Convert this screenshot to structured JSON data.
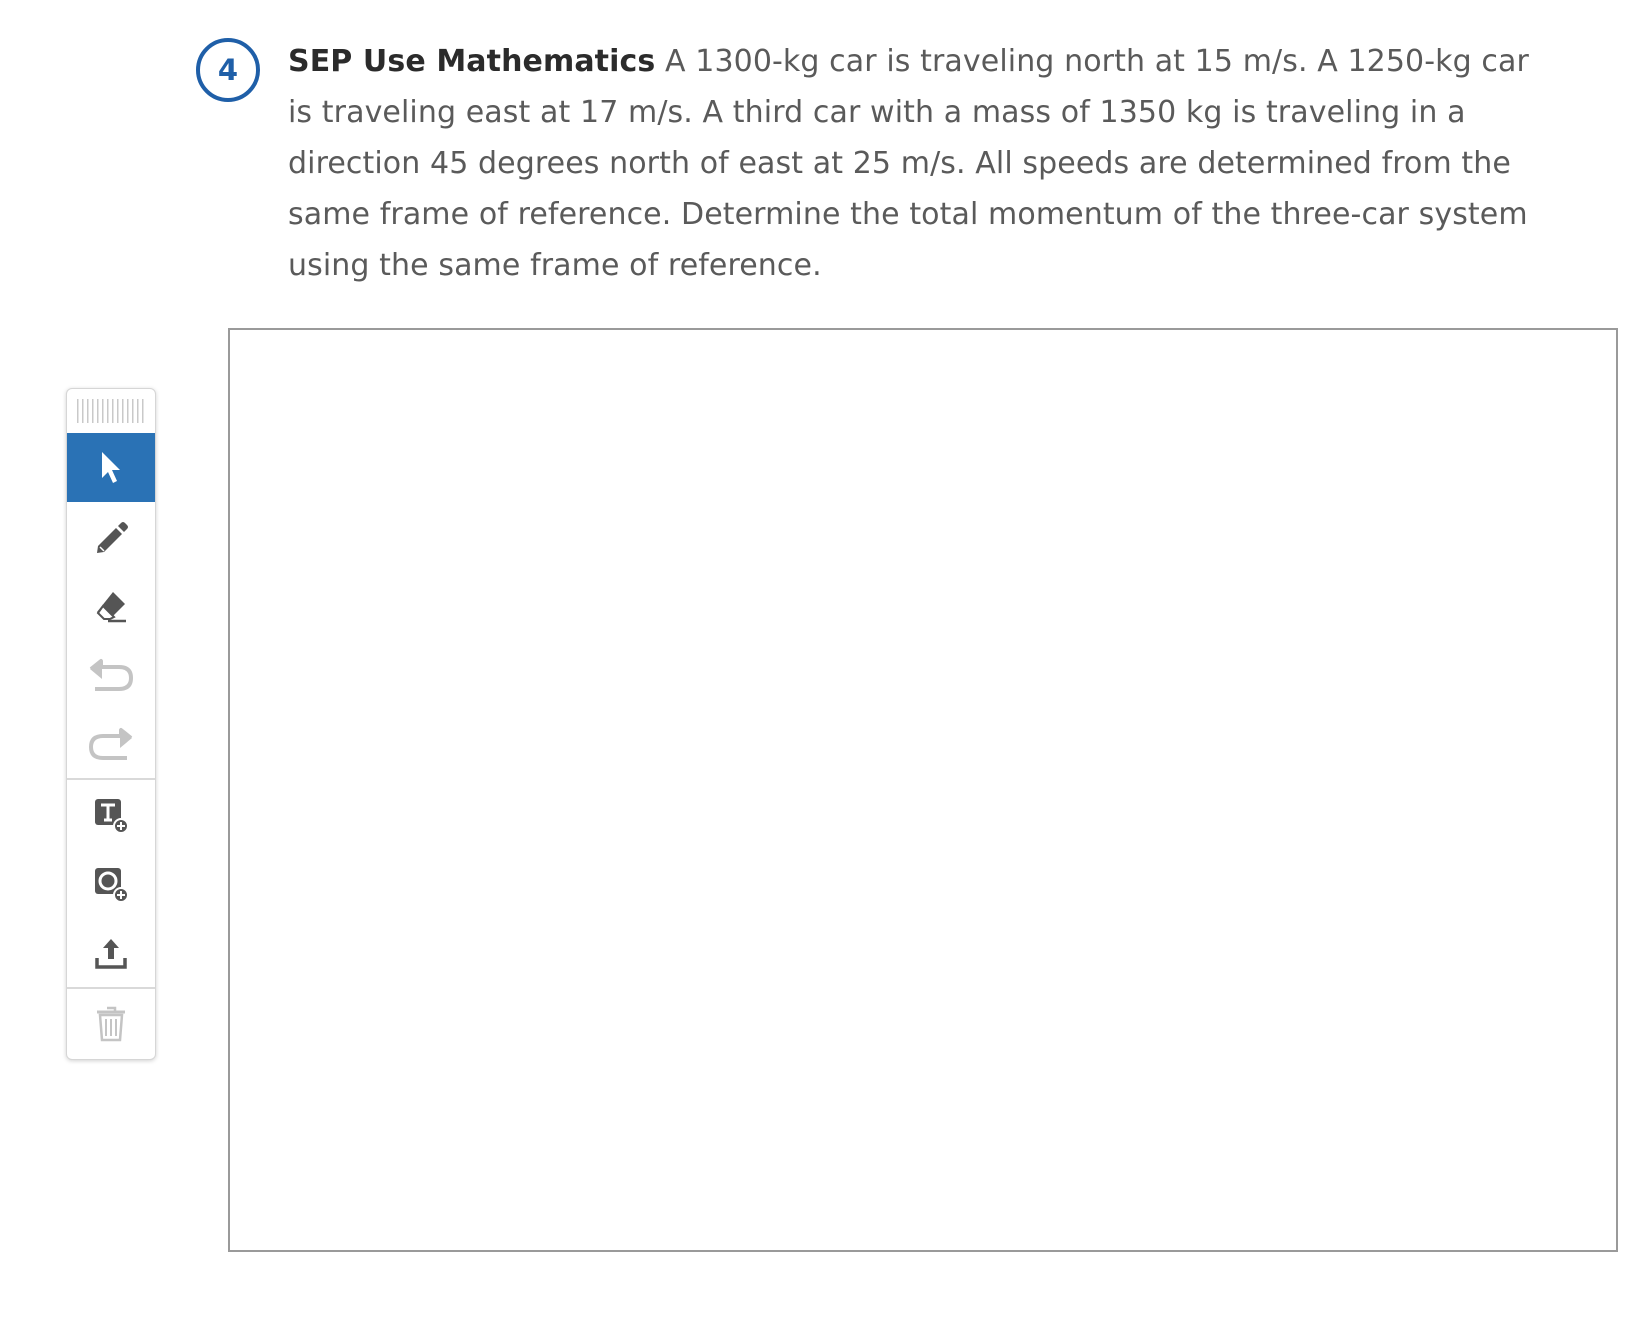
{
  "question": {
    "number": "4",
    "lead": "SEP Use Mathematics",
    "body": " A 1300-kg car is traveling north at 15 m/s. A 1250-kg car is traveling east at 17 m/s. A third car with a mass of 1350 kg is traveling in a direction 45 degrees north of east at 25 m/s. All speeds are determined from the same frame of reference. Determine the total momentum of the three-car system using the same frame of reference."
  },
  "toolbar": {
    "active_tool": "select",
    "tools": [
      {
        "icon": "cursor-icon",
        "state": "active"
      },
      {
        "icon": "pencil-icon",
        "state": "enabled"
      },
      {
        "icon": "eraser-icon",
        "state": "enabled"
      },
      {
        "icon": "undo-icon",
        "state": "disabled"
      },
      {
        "icon": "redo-icon",
        "state": "disabled"
      },
      {
        "icon": "add-text-icon",
        "state": "enabled"
      },
      {
        "icon": "add-shape-icon",
        "state": "enabled"
      },
      {
        "icon": "upload-icon",
        "state": "enabled"
      },
      {
        "icon": "trash-icon",
        "state": "disabled"
      }
    ]
  },
  "colors": {
    "accent": "#2a72b5",
    "badge": "#1f5fa8",
    "text": "#5a5a5a",
    "lead_text": "#2b2b2b",
    "icon": "#555555",
    "icon_disabled": "#c4c4c4",
    "canvas_border": "#9a9a9a"
  }
}
